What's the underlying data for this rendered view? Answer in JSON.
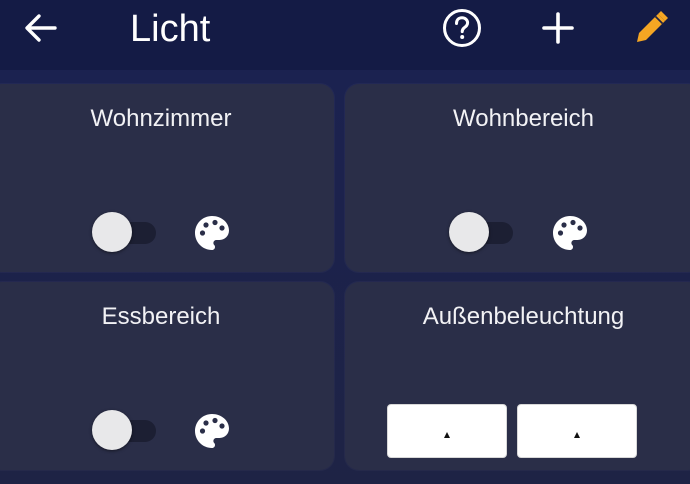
{
  "header": {
    "title": "Licht",
    "icons": [
      "arrow-left-icon",
      "help-circle-icon",
      "plus-icon",
      "pencil-icon"
    ],
    "accent_color": "#f5a623"
  },
  "cards": [
    {
      "title": "Wohnzimmer",
      "switch_on": false,
      "icon": "palette-icon"
    },
    {
      "title": "Wohnbereich",
      "switch_on": false,
      "icon": "palette-icon"
    },
    {
      "title": "Essbereich",
      "switch_on": false,
      "icon": "palette-icon"
    },
    {
      "title": "Außenbeleuchtung",
      "controls": [
        "slider-box",
        "slider-box"
      ]
    }
  ]
}
